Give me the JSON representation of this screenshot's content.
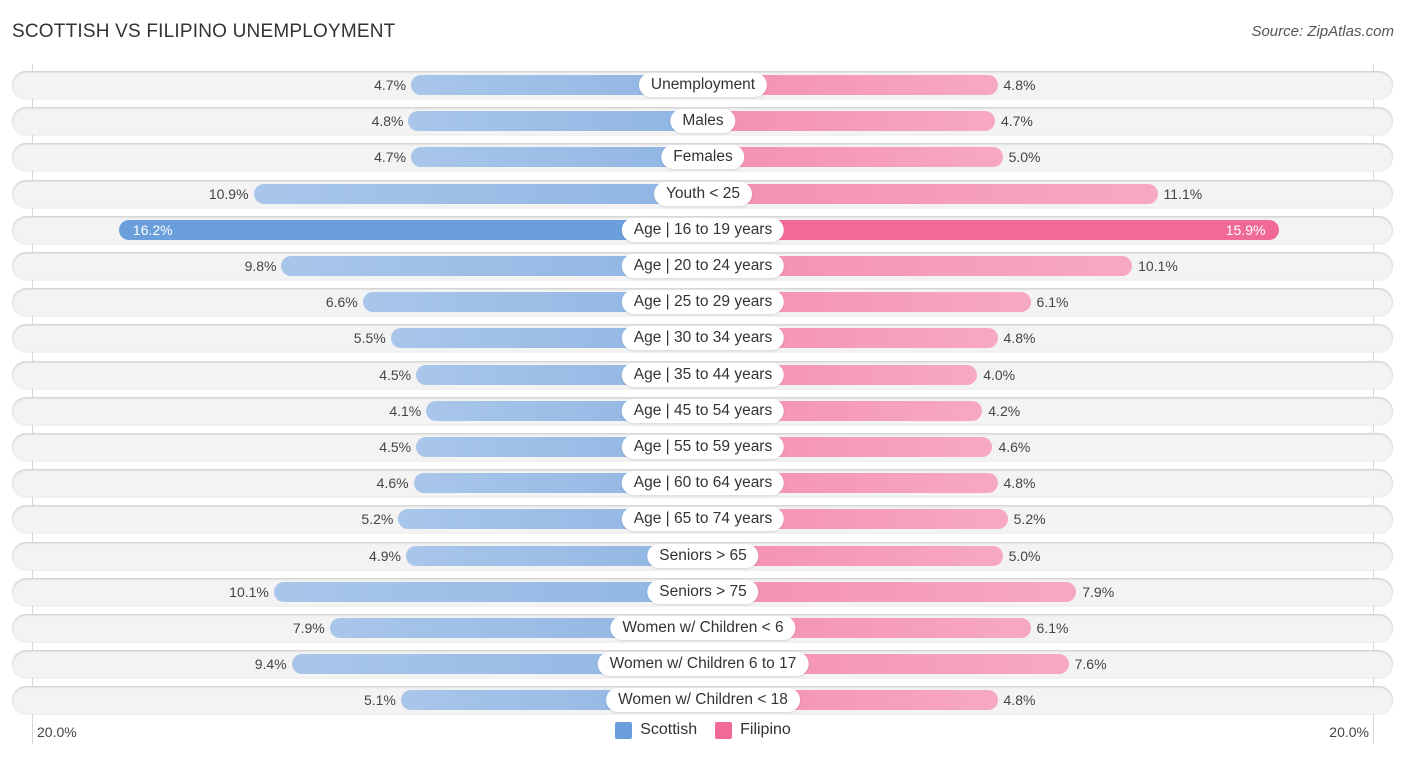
{
  "header": {
    "title": "SCOTTISH VS FILIPINO UNEMPLOYMENT",
    "source": "Source: ZipAtlas.com"
  },
  "legend": {
    "items": [
      {
        "label": "Scottish",
        "color": "#6a9fdc"
      },
      {
        "label": "Filipino",
        "color": "#f06a95"
      }
    ]
  },
  "axis": {
    "left_label": "20.0%",
    "right_label": "20.0%"
  },
  "chart_data": {
    "type": "bar",
    "orientation": "horizontal-diverging",
    "title": "SCOTTISH VS FILIPINO UNEMPLOYMENT",
    "xlim": [
      0,
      20.0
    ],
    "unit": "%",
    "legend_position": "bottom-center",
    "categories": [
      "Unemployment",
      "Males",
      "Females",
      "Youth < 25",
      "Age | 16 to 19 years",
      "Age | 20 to 24 years",
      "Age | 25 to 29 years",
      "Age | 30 to 34 years",
      "Age | 35 to 44 years",
      "Age | 45 to 54 years",
      "Age | 55 to 59 years",
      "Age | 60 to 64 years",
      "Age | 65 to 74 years",
      "Seniors > 65",
      "Seniors > 75",
      "Women w/ Children < 6",
      "Women w/ Children 6 to 17",
      "Women w/ Children < 18"
    ],
    "series": [
      {
        "name": "Scottish",
        "color": "#6a9fdc",
        "values": [
          4.7,
          4.8,
          4.7,
          10.9,
          16.2,
          9.8,
          6.6,
          5.5,
          4.5,
          4.1,
          4.5,
          4.6,
          5.2,
          4.9,
          10.1,
          7.9,
          9.4,
          5.1
        ],
        "labels": [
          "4.7%",
          "4.8%",
          "4.7%",
          "10.9%",
          "16.2%",
          "9.8%",
          "6.6%",
          "5.5%",
          "4.5%",
          "4.1%",
          "4.5%",
          "4.6%",
          "5.2%",
          "4.9%",
          "10.1%",
          "7.9%",
          "9.4%",
          "5.1%"
        ]
      },
      {
        "name": "Filipino",
        "color": "#f06a95",
        "values": [
          4.8,
          4.7,
          5.0,
          11.1,
          15.9,
          10.1,
          6.1,
          4.8,
          4.0,
          4.2,
          4.6,
          4.8,
          5.2,
          5.0,
          7.9,
          6.1,
          7.6,
          4.8
        ],
        "labels": [
          "4.8%",
          "4.7%",
          "5.0%",
          "11.1%",
          "15.9%",
          "10.1%",
          "6.1%",
          "4.8%",
          "4.0%",
          "4.2%",
          "4.6%",
          "4.8%",
          "5.2%",
          "5.0%",
          "7.9%",
          "6.1%",
          "7.6%",
          "4.8%"
        ]
      }
    ],
    "highlight_index": 4
  }
}
